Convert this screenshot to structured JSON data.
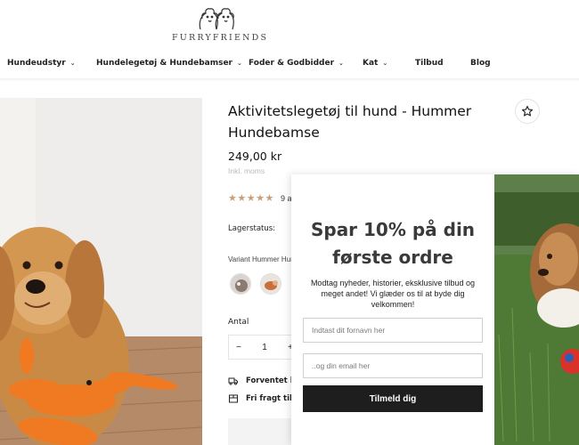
{
  "brand": {
    "name": "FURRYFRIENDS"
  },
  "nav": {
    "items": [
      {
        "label": "Hundeudstyr",
        "dropdown": true
      },
      {
        "label": "Hundelegetøj & Hundebamser",
        "dropdown": true
      },
      {
        "label": "Foder & Godbidder",
        "dropdown": true
      },
      {
        "label": "Kat",
        "dropdown": true
      },
      {
        "label": "Tilbud",
        "dropdown": false
      },
      {
        "label": "Blog",
        "dropdown": false
      }
    ]
  },
  "product": {
    "title": "Aktivitetslegetøj til hund - Hummer Hundebamse",
    "price": "249,00 kr",
    "tax_note": "Inkl. moms",
    "rating": {
      "stars": "★★★★★",
      "text": "9 a"
    },
    "stock_label": "Lagerstatus:",
    "variant_label": "Variant Hummer Hun",
    "quantity_label": "Antal",
    "quantity": {
      "minus": "−",
      "value": "1",
      "plus": "+"
    },
    "delivery_text": "Forventet lev",
    "shipping_text": "Fri fragt til p"
  },
  "popup": {
    "title": "Spar 10% på din første ordre",
    "subtitle": "Modtag nyheder, historier, eksklusive tilbud og meget andet! Vi glæder os til at byde dig velkommen!",
    "first_name_placeholder": "Indtast dit fornavn her",
    "email_placeholder": "..og din email her",
    "button_label": "Tilmeld dig"
  },
  "colors": {
    "accent_star": "#c6a07a",
    "button_bg": "#1e1e1e",
    "title_gray": "#3a3a3a"
  },
  "icons": [
    "dogs-logo-icon",
    "chevron-down-icon",
    "star-outline-icon",
    "truck-icon",
    "box-icon"
  ]
}
